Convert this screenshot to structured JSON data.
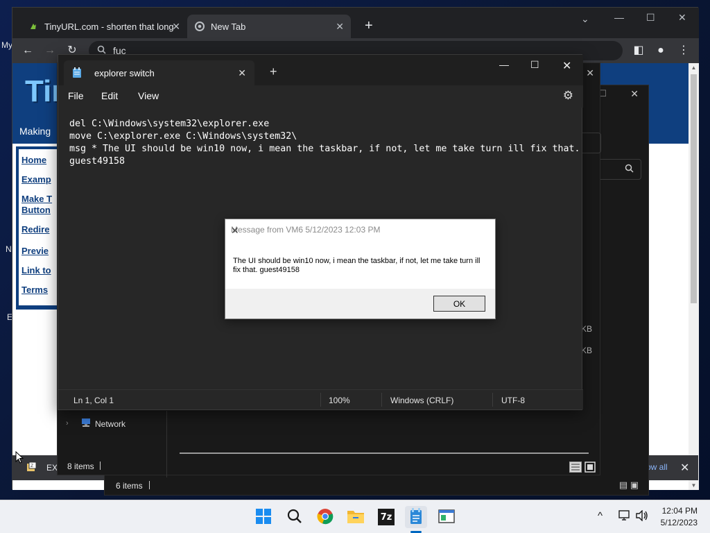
{
  "desktop": {
    "frag_my": "My",
    "frag_n": "N",
    "frag_e": "E"
  },
  "chrome": {
    "tabs": [
      {
        "label": "TinyURL.com - shorten that long",
        "close": "✕"
      },
      {
        "label": "New Tab",
        "close": "✕"
      }
    ],
    "new_tab": "+",
    "omnibox_value": "fuc",
    "page": {
      "logo": "Tin",
      "tagline": "Making",
      "nav": [
        "Home",
        "Examp",
        "Make T",
        "Button",
        "Redire",
        "Previe",
        "Link to",
        "Terms"
      ]
    }
  },
  "downloads_bar": {
    "item": "EX",
    "show_all": "ow all",
    "close": "✕"
  },
  "explorer_front": {
    "status": "8 items",
    "nav_item": "Network",
    "sizes": [
      "KB",
      "KB"
    ]
  },
  "explorer_back": {
    "status": "6 items"
  },
  "notepad": {
    "tab_title": "explorer switch",
    "menu": [
      "File",
      "Edit",
      "View"
    ],
    "lines": [
      "del C:\\Windows\\system32\\explorer.exe",
      "move C:\\explorer.exe C:\\Windows\\system32\\",
      "msg * The UI should be win10 now, i mean the taskbar, if not, let me take turn ill fix that.",
      "guest49158"
    ],
    "status": {
      "position": "Ln 1, Col 1",
      "zoom": "100%",
      "line_ending": "Windows (CRLF)",
      "encoding": "UTF-8"
    }
  },
  "message_box": {
    "title": "Message from VM6 5/12/2023 12:03 PM",
    "text": "The UI should be win10 now, i mean the taskbar, if not, let me take turn ill fix that. guest49158",
    "ok_label": "OK"
  },
  "taskbar": {
    "apps": [
      "start-icon",
      "search-icon",
      "chrome-icon",
      "file-explorer-icon",
      "7zip-icon",
      "notepad-icon",
      "terminal-icon"
    ],
    "seven_zip_label": "7z",
    "tray_chevron": "^",
    "time": "12:04 PM",
    "date": "5/12/2023"
  },
  "colors": {
    "accent": "#0067c0",
    "notepad_bg": "#272727",
    "tiny_blue": "#0f3f7f"
  }
}
